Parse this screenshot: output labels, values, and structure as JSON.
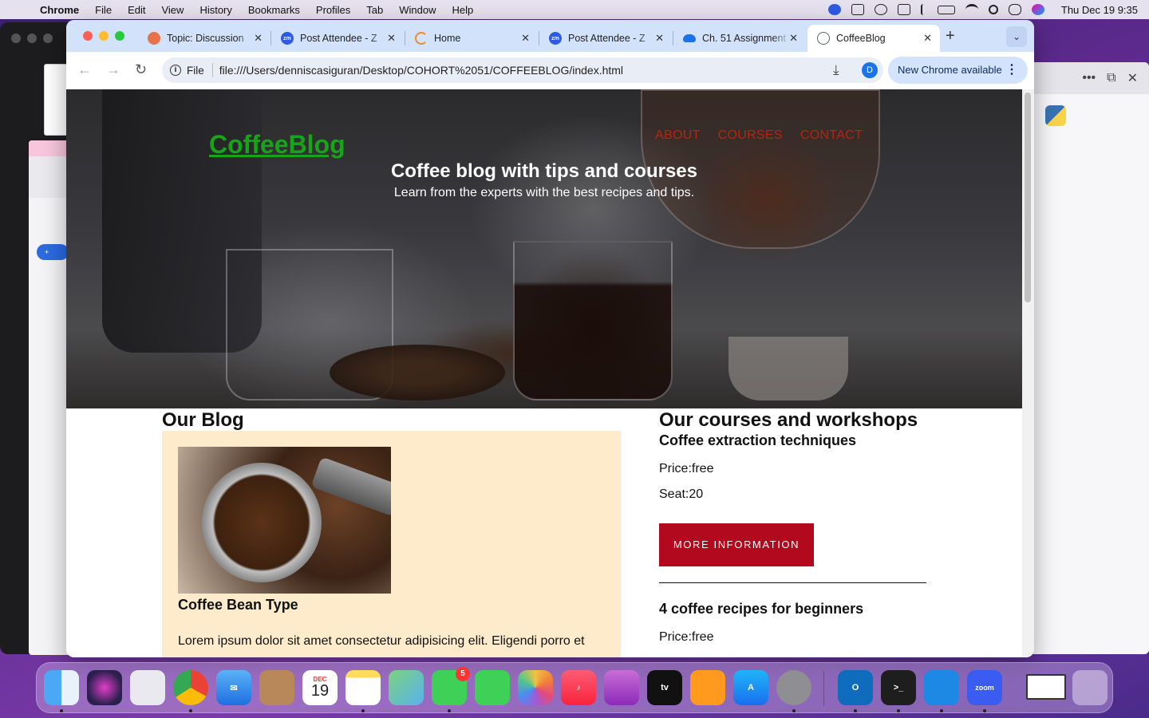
{
  "menubar": {
    "app_name": "Chrome",
    "items": [
      "File",
      "Edit",
      "View",
      "History",
      "Bookmarks",
      "Profiles",
      "Tab",
      "Window",
      "Help"
    ],
    "clock": "Thu Dec 19  9:35"
  },
  "browser": {
    "tabs": [
      {
        "label": "Topic: Discussion",
        "icon": "discussion-icon",
        "color": "#e8734a"
      },
      {
        "label": "Post Attendee - Z",
        "icon": "zoom-icon",
        "color": "#2d5be3"
      },
      {
        "label": "Home",
        "icon": "home-loading-icon",
        "color": "#f08a24"
      },
      {
        "label": "Post Attendee - Z",
        "icon": "zoom-icon",
        "color": "#2d5be3"
      },
      {
        "label": "Ch. 51 Assignment",
        "icon": "cloud-icon",
        "color": "#1a73e8"
      },
      {
        "label": "CoffeeBlog",
        "icon": "globe-icon",
        "color": "#5f6368"
      }
    ],
    "address_scheme": "File",
    "address_url": "file:///Users/denniscasiguran/Desktop/COHORT%2051/COFFEEBLOG/index.html",
    "profile_initial": "D",
    "update_label": "New Chrome available"
  },
  "page": {
    "logo": "CoffeeBlog",
    "nav": [
      "ABOUT",
      "COURSES",
      "CONTACT"
    ],
    "hero_title": "Coffee blog with tips and courses",
    "hero_subtitle": "Learn from the experts with the best recipes and tips.",
    "blog_heading": "Our Blog",
    "blog_post": {
      "title": "Coffee Bean Type",
      "text": "Lorem ipsum dolor sit amet consectetur adipisicing elit. Eligendi porro et"
    },
    "courses_heading": "Our courses and workshops",
    "courses": [
      {
        "title": "Coffee extraction techniques",
        "price": "Price:free",
        "seat": "Seat:20",
        "button": "MORE INFORMATION"
      },
      {
        "title": "4 coffee recipes for beginners",
        "price": "Price:free"
      }
    ],
    "colors": {
      "logo": "#16a516",
      "nav": "#b3260e",
      "button": "#b3091e",
      "card_bg": "#fdebcb"
    }
  },
  "dock": {
    "apps": [
      "Finder",
      "Siri",
      "Launchpad",
      "Chrome",
      "Mail",
      "Contacts",
      "Calendar",
      "Notes",
      "Maps",
      "Messages",
      "FaceTime",
      "Photos",
      "Music",
      "Podcasts",
      "TV",
      "Books",
      "App Store",
      "System Settings",
      "Outlook",
      "Terminal",
      "VS Code",
      "Zoom"
    ],
    "calendar_month": "DEC",
    "calendar_day": "19",
    "messages_badge": "5"
  }
}
